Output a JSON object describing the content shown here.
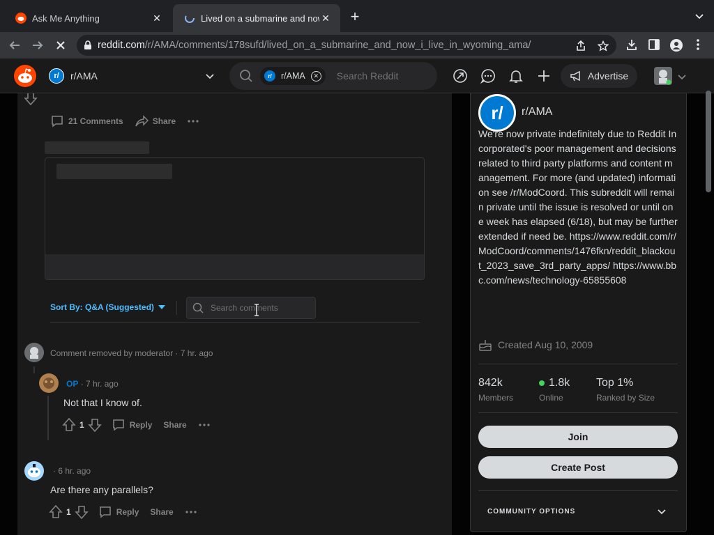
{
  "browser": {
    "tabs": [
      {
        "title": "Ask Me Anything",
        "active": false
      },
      {
        "title": "Lived on a submarine and now i live in wyoming",
        "active": true
      }
    ],
    "url_host": "reddit.com",
    "url_path": "/r/AMA/comments/178sufd/lived_on_a_submarine_and_now_i_live_in_wyoming_ama/"
  },
  "header": {
    "community": "r/AMA",
    "search_chip": "r/AMA",
    "search_placeholder": "Search Reddit",
    "advertise_label": "Advertise"
  },
  "post": {
    "comments_label": "21 Comments",
    "share_label": "Share"
  },
  "comments_panel": {
    "sort_label": "Sort By: Q&A (Suggested)",
    "search_placeholder": "Search comments"
  },
  "comments": [
    {
      "meta": "Comment removed by moderator · 7 hr. ago"
    },
    {
      "author": "OP",
      "time": "· 7 hr. ago",
      "text": "Not that I know of.",
      "votes": "1",
      "reply": "Reply",
      "share": "Share"
    },
    {
      "time": "· 6 hr. ago",
      "text": "Are there any parallels?",
      "votes": "1",
      "reply": "Reply",
      "share": "Share"
    }
  ],
  "sidebar": {
    "name": "r/AMA",
    "description": "We're now private indefinitely due to Reddit Incorporated's poor management and decisions related to third party platforms and content management. For more (and updated) information see /r/ModCoord. This subreddit will remain private until the issue is resolved or until one week has elapsed (6/18), but may be further extended if need be. https://www.reddit.com/r/ModCoord/comments/1476fkn/reddit_blackout_2023_save_3rd_party_apps/ https://www.bbc.com/news/technology-65855608",
    "created": "Created Aug 10, 2009",
    "stats": [
      {
        "value": "842k",
        "label": "Members"
      },
      {
        "value": "1.8k",
        "label": "Online"
      },
      {
        "value": "Top 1%",
        "label": "Ranked by Size"
      }
    ],
    "join_label": "Join",
    "create_post_label": "Create Post",
    "community_options_label": "COMMUNITY OPTIONS"
  },
  "colors": {
    "accent": "#0079d3",
    "orangered": "#ff4500",
    "online": "#46d160"
  }
}
